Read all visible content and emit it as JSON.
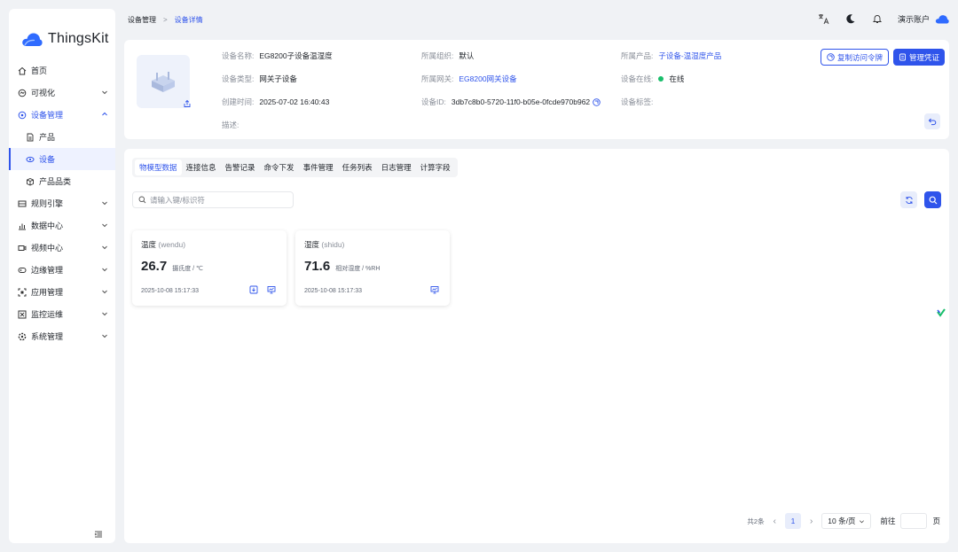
{
  "app": {
    "name": "ThingsKit"
  },
  "sidebar": {
    "items": [
      {
        "label": "首页",
        "icon": "home-icon"
      },
      {
        "label": "可视化",
        "icon": "visual-icon"
      },
      {
        "label": "设备管理",
        "icon": "device-mgmt-icon"
      },
      {
        "label": "产品",
        "icon": "product-icon"
      },
      {
        "label": "设备",
        "icon": "device-icon"
      },
      {
        "label": "产品品类",
        "icon": "category-icon"
      },
      {
        "label": "规则引擎",
        "icon": "rule-icon"
      },
      {
        "label": "数据中心",
        "icon": "data-icon"
      },
      {
        "label": "视频中心",
        "icon": "video-icon"
      },
      {
        "label": "边缘管理",
        "icon": "edge-icon"
      },
      {
        "label": "应用管理",
        "icon": "app-icon"
      },
      {
        "label": "监控运维",
        "icon": "monitor-icon"
      },
      {
        "label": "系统管理",
        "icon": "system-icon"
      }
    ]
  },
  "breadcrumb": {
    "parent": "设备管理",
    "separator": ">",
    "current": "设备详情"
  },
  "header": {
    "account": "演示账户"
  },
  "device": {
    "name_label": "设备名称:",
    "name": "EG8200子设备温湿度",
    "org_label": "所属组织:",
    "org": "默认",
    "product_label": "所属产品:",
    "product": "子设备-温湿度产品",
    "type_label": "设备类型:",
    "type": "网关子设备",
    "gateway_label": "所属网关:",
    "gateway": "EG8200网关设备",
    "online_label": "设备在线:",
    "online": "在线",
    "created_label": "创建时间:",
    "created": "2025-07-02 16:40:43",
    "id_label": "设备ID:",
    "id": "3db7c8b0-5720-11f0-b05e-0fcde970b962",
    "tag_label": "设备标签:",
    "desc_label": "描述:",
    "copy_token_label": "复制访问令牌",
    "manage_cred_label": "管理凭证"
  },
  "tabs": [
    "物模型数据",
    "连接信息",
    "告警记录",
    "命令下发",
    "事件管理",
    "任务列表",
    "日志管理",
    "计算字段"
  ],
  "search": {
    "placeholder": "请输入键/标识符"
  },
  "properties": [
    {
      "name": "温度",
      "id": "(wendu)",
      "value": "26.7",
      "unit": "摄氏度 / ℃",
      "time": "2025-10-08 15:17:33"
    },
    {
      "name": "湿度",
      "id": "(shidu)",
      "value": "71.6",
      "unit": "相对湿度 / %RH",
      "time": "2025-10-08 15:17:33"
    }
  ],
  "pagination": {
    "total": "共2条",
    "current": "1",
    "page_size": "10 条/页",
    "goto": "前往",
    "page_suffix": "页"
  },
  "colors": {
    "primary": "#2f54eb",
    "online": "#19be6b"
  }
}
